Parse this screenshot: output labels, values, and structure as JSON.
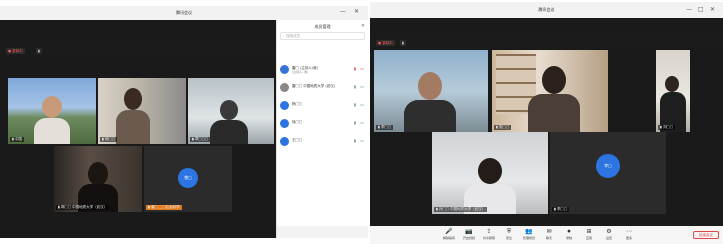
{
  "left_window": {
    "title": "腾讯会议",
    "toolbar": {
      "record": "● 录制中",
      "share": "▮"
    },
    "participants": [
      {
        "name": "中国"
      },
      {
        "name": "杨□□"
      },
      {
        "name": "章□□□"
      },
      {
        "name": "郭□□ 中国地质大学（武汉）"
      },
      {
        "name": "雷□ 二□社会科学",
        "avatar_text": "曾□",
        "avatar_color": "#2b74e2"
      }
    ],
    "panel": {
      "title": "成员管理",
      "search_placeholder": "搜索成员",
      "members": [
        {
          "name": "雷□ (主持人/我)",
          "sub": "(主持人, 我)",
          "color": "#3a73d8"
        },
        {
          "name": "雷□□ 中国地质大学 (武汉)",
          "sub": "",
          "color": "#888888"
        },
        {
          "name": "杨□□",
          "sub": "",
          "color": "#2b74e2"
        },
        {
          "name": "徐□□",
          "sub": "",
          "color": "#2b74e2"
        },
        {
          "name": "王□□",
          "sub": "",
          "color": "#2b74e2"
        }
      ]
    }
  },
  "right_window": {
    "title": "腾讯会议",
    "toolbar": {
      "record": "● 录制中",
      "share": "▮"
    },
    "participants": [
      {
        "name": "李□□"
      },
      {
        "name": "张□□"
      },
      {
        "name": "刘□□"
      },
      {
        "name": "孙□□ 中国地质大学（武汉）"
      },
      {
        "name": "李□□",
        "avatar_text": "李□",
        "avatar_color": "#2b74e2"
      }
    ],
    "bottom_bar": [
      {
        "icon": "mic-icon",
        "glyph": "🎤",
        "label": "解除静音"
      },
      {
        "icon": "camera-icon",
        "glyph": "📷",
        "label": "开启视频"
      },
      {
        "icon": "share-icon",
        "glyph": "⇪",
        "label": "共享屏幕"
      },
      {
        "icon": "security-icon",
        "glyph": "⛨",
        "label": "安全"
      },
      {
        "icon": "members-icon",
        "glyph": "👥",
        "label": "管理成员"
      },
      {
        "icon": "chat-icon",
        "glyph": "✉",
        "label": "聊天"
      },
      {
        "icon": "record-icon",
        "glyph": "⏺",
        "label": "录制"
      },
      {
        "icon": "apps-icon",
        "glyph": "⊞",
        "label": "应用"
      },
      {
        "icon": "settings-icon",
        "glyph": "⚙",
        "label": "设置"
      },
      {
        "icon": "more-icon",
        "glyph": "⋯",
        "label": "更多"
      }
    ],
    "end_button": "结束会议"
  }
}
